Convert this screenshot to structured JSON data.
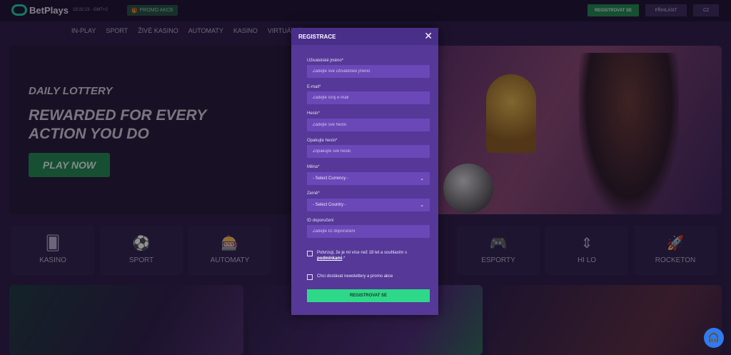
{
  "header": {
    "logo": "BetPlays",
    "clock": "19:32:23 - GMT+2",
    "promo_label": "PROMO AKCE",
    "register_label": "REGISTROVAT SE",
    "login_label": "PŘIHLÁSIT",
    "language": "CZ"
  },
  "nav": {
    "items": [
      "IN-PLAY",
      "SPORT",
      "ŽIVÉ KASINO",
      "AUTOMATY",
      "KASINO",
      "VIRTUÁLNÍ"
    ]
  },
  "hero": {
    "kicker": "DAILY LOTTERY",
    "headline": "REWARDED FOR EVERY ACTION YOU DO",
    "cta": "PLAY NOW"
  },
  "categories": [
    {
      "label": "KASINO",
      "icon": "cards-icon"
    },
    {
      "label": "SPORT",
      "icon": "soccer-ball-icon"
    },
    {
      "label": "AUTOMATY",
      "icon": "slot-machine-icon"
    },
    {
      "label": "ESPORTY",
      "icon": "gamepad-icon"
    },
    {
      "label": "HI LO",
      "icon": "up-down-arrow-icon"
    },
    {
      "label": "ROCKETON",
      "icon": "rocket-icon"
    }
  ],
  "modal": {
    "title": "REGISTRACE",
    "close_icon": "close-icon",
    "username_label": "Uživatelské jméno*",
    "username_placeholder": "Zadejte své uživatelské jméno",
    "email_label": "E-mail*",
    "email_placeholder": "Zadejte svůj e-mail",
    "password_label": "Heslo*",
    "password_placeholder": "Zadejte své heslo",
    "password_repeat_label": "Opakujte heslo*",
    "password_repeat_placeholder": "Zopakujte své heslo",
    "currency_label": "Měna*",
    "currency_value": "- Select Currency -",
    "country_label": "Země*",
    "country_value": "- Select Country -",
    "referral_label": "ID doporučení",
    "referral_placeholder": "Zadejte ID doporučení",
    "terms_text": "Potvrzuji, že je mi více než 18 let a souhlasím s",
    "terms_link": "podmínkami",
    "terms_suffix": ".*",
    "newsletter_text": "Chci dostávat newslettery a promo akce",
    "submit_label": "REGISTROVAT SE"
  },
  "colors": {
    "accent": "#2ed889",
    "modal_bg": "#553897",
    "field_bg": "#6b48b8",
    "page_bg": "#2a1d44"
  }
}
